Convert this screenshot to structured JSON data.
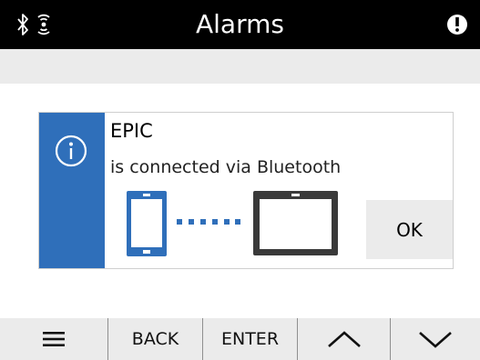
{
  "header": {
    "title": "Alarms",
    "icons": [
      "bluetooth-icon",
      "signal-icon",
      "alert-icon"
    ]
  },
  "dialog": {
    "title": "EPIC",
    "message": "is connected via Bluetooth",
    "ok_label": "OK",
    "icons": [
      "info-icon",
      "phone-icon",
      "tablet-icon"
    ]
  },
  "footer": {
    "menu_icon": "menu-icon",
    "back_label": "BACK",
    "enter_label": "ENTER",
    "up_icon": "chevron-up-icon",
    "down_icon": "chevron-down-icon"
  },
  "colors": {
    "header_bg": "#000000",
    "accent_blue": "#2f6fba",
    "device_dark": "#3a3a3a",
    "button_bg": "#ebebeb"
  }
}
